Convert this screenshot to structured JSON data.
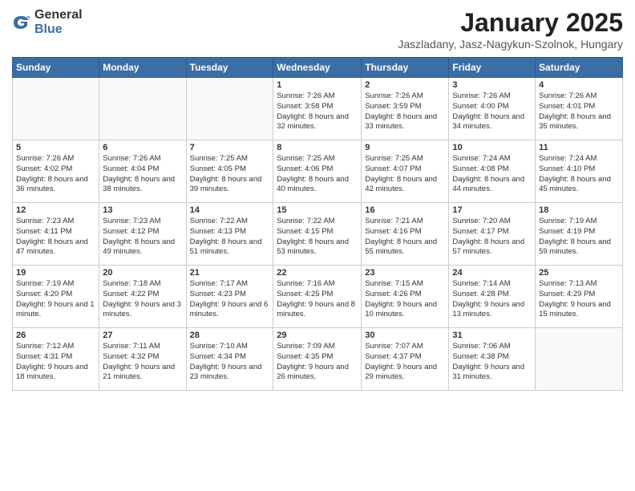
{
  "logo": {
    "general": "General",
    "blue": "Blue"
  },
  "title": "January 2025",
  "subtitle": "Jaszladany, Jasz-Nagykun-Szolnok, Hungary",
  "headers": [
    "Sunday",
    "Monday",
    "Tuesday",
    "Wednesday",
    "Thursday",
    "Friday",
    "Saturday"
  ],
  "weeks": [
    [
      {
        "day": "",
        "info": ""
      },
      {
        "day": "",
        "info": ""
      },
      {
        "day": "",
        "info": ""
      },
      {
        "day": "1",
        "info": "Sunrise: 7:26 AM\nSunset: 3:58 PM\nDaylight: 8 hours and 32 minutes."
      },
      {
        "day": "2",
        "info": "Sunrise: 7:26 AM\nSunset: 3:59 PM\nDaylight: 8 hours and 33 minutes."
      },
      {
        "day": "3",
        "info": "Sunrise: 7:26 AM\nSunset: 4:00 PM\nDaylight: 8 hours and 34 minutes."
      },
      {
        "day": "4",
        "info": "Sunrise: 7:26 AM\nSunset: 4:01 PM\nDaylight: 8 hours and 35 minutes."
      }
    ],
    [
      {
        "day": "5",
        "info": "Sunrise: 7:26 AM\nSunset: 4:02 PM\nDaylight: 8 hours and 36 minutes."
      },
      {
        "day": "6",
        "info": "Sunrise: 7:26 AM\nSunset: 4:04 PM\nDaylight: 8 hours and 38 minutes."
      },
      {
        "day": "7",
        "info": "Sunrise: 7:25 AM\nSunset: 4:05 PM\nDaylight: 8 hours and 39 minutes."
      },
      {
        "day": "8",
        "info": "Sunrise: 7:25 AM\nSunset: 4:06 PM\nDaylight: 8 hours and 40 minutes."
      },
      {
        "day": "9",
        "info": "Sunrise: 7:25 AM\nSunset: 4:07 PM\nDaylight: 8 hours and 42 minutes."
      },
      {
        "day": "10",
        "info": "Sunrise: 7:24 AM\nSunset: 4:08 PM\nDaylight: 8 hours and 44 minutes."
      },
      {
        "day": "11",
        "info": "Sunrise: 7:24 AM\nSunset: 4:10 PM\nDaylight: 8 hours and 45 minutes."
      }
    ],
    [
      {
        "day": "12",
        "info": "Sunrise: 7:23 AM\nSunset: 4:11 PM\nDaylight: 8 hours and 47 minutes."
      },
      {
        "day": "13",
        "info": "Sunrise: 7:23 AM\nSunset: 4:12 PM\nDaylight: 8 hours and 49 minutes."
      },
      {
        "day": "14",
        "info": "Sunrise: 7:22 AM\nSunset: 4:13 PM\nDaylight: 8 hours and 51 minutes."
      },
      {
        "day": "15",
        "info": "Sunrise: 7:22 AM\nSunset: 4:15 PM\nDaylight: 8 hours and 53 minutes."
      },
      {
        "day": "16",
        "info": "Sunrise: 7:21 AM\nSunset: 4:16 PM\nDaylight: 8 hours and 55 minutes."
      },
      {
        "day": "17",
        "info": "Sunrise: 7:20 AM\nSunset: 4:17 PM\nDaylight: 8 hours and 57 minutes."
      },
      {
        "day": "18",
        "info": "Sunrise: 7:19 AM\nSunset: 4:19 PM\nDaylight: 8 hours and 59 minutes."
      }
    ],
    [
      {
        "day": "19",
        "info": "Sunrise: 7:19 AM\nSunset: 4:20 PM\nDaylight: 9 hours and 1 minute."
      },
      {
        "day": "20",
        "info": "Sunrise: 7:18 AM\nSunset: 4:22 PM\nDaylight: 9 hours and 3 minutes."
      },
      {
        "day": "21",
        "info": "Sunrise: 7:17 AM\nSunset: 4:23 PM\nDaylight: 9 hours and 6 minutes."
      },
      {
        "day": "22",
        "info": "Sunrise: 7:16 AM\nSunset: 4:25 PM\nDaylight: 9 hours and 8 minutes."
      },
      {
        "day": "23",
        "info": "Sunrise: 7:15 AM\nSunset: 4:26 PM\nDaylight: 9 hours and 10 minutes."
      },
      {
        "day": "24",
        "info": "Sunrise: 7:14 AM\nSunset: 4:28 PM\nDaylight: 9 hours and 13 minutes."
      },
      {
        "day": "25",
        "info": "Sunrise: 7:13 AM\nSunset: 4:29 PM\nDaylight: 9 hours and 15 minutes."
      }
    ],
    [
      {
        "day": "26",
        "info": "Sunrise: 7:12 AM\nSunset: 4:31 PM\nDaylight: 9 hours and 18 minutes."
      },
      {
        "day": "27",
        "info": "Sunrise: 7:11 AM\nSunset: 4:32 PM\nDaylight: 9 hours and 21 minutes."
      },
      {
        "day": "28",
        "info": "Sunrise: 7:10 AM\nSunset: 4:34 PM\nDaylight: 9 hours and 23 minutes."
      },
      {
        "day": "29",
        "info": "Sunrise: 7:09 AM\nSunset: 4:35 PM\nDaylight: 9 hours and 26 minutes."
      },
      {
        "day": "30",
        "info": "Sunrise: 7:07 AM\nSunset: 4:37 PM\nDaylight: 9 hours and 29 minutes."
      },
      {
        "day": "31",
        "info": "Sunrise: 7:06 AM\nSunset: 4:38 PM\nDaylight: 9 hours and 31 minutes."
      },
      {
        "day": "",
        "info": ""
      }
    ]
  ]
}
